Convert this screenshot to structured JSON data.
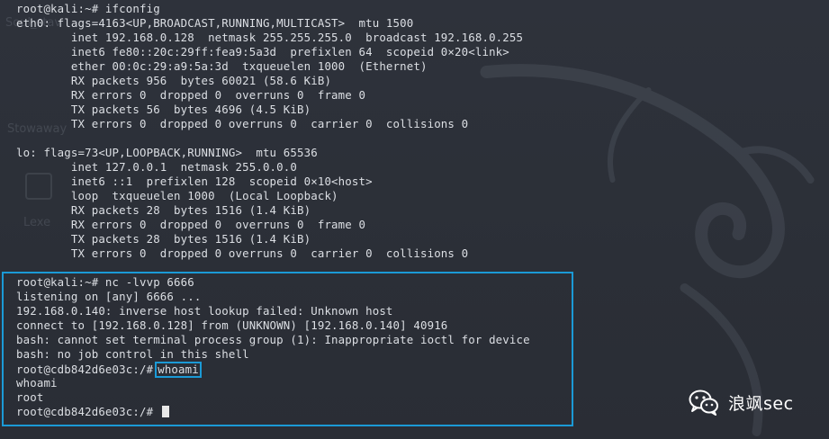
{
  "terminal": {
    "block1": [
      "root@kali:~# ifconfig",
      "eth0: flags=4163<UP,BROADCAST,RUNNING,MULTICAST>  mtu 1500",
      "        inet 192.168.0.128  netmask 255.255.255.0  broadcast 192.168.0.255",
      "        inet6 fe80::20c:29ff:fea9:5a3d  prefixlen 64  scopeid 0×20<link>",
      "        ether 00:0c:29:a9:5a:3d  txqueuelen 1000  (Ethernet)",
      "        RX packets 956  bytes 60021 (58.6 KiB)",
      "        RX errors 0  dropped 0  overruns 0  frame 0",
      "        TX packets 56  bytes 4696 (4.5 KiB)",
      "        TX errors 0  dropped 0 overruns 0  carrier 0  collisions 0",
      "",
      "lo: flags=73<UP,LOOPBACK,RUNNING>  mtu 65536",
      "        inet 127.0.0.1  netmask 255.0.0.0",
      "        inet6 ::1  prefixlen 128  scopeid 0×10<host>",
      "        loop  txqueuelen 1000  (Local Loopback)",
      "        RX packets 28  bytes 1516 (1.4 KiB)",
      "        RX errors 0  dropped 0  overruns 0  frame 0",
      "        TX packets 28  bytes 1516 (1.4 KiB)",
      "        TX errors 0  dropped 0 overruns 0  carrier 0  collisions 0"
    ],
    "block2": [
      "root@kali:~# nc -lvvp 6666",
      "listening on [any] 6666 ...",
      "192.168.0.140: inverse host lookup failed: Unknown host",
      "connect to [192.168.0.128] from (UNKNOWN) [192.168.0.140] 40916",
      "bash: cannot set terminal process group (1): Inappropriate ioctl for device",
      "bash: no job control in this shell"
    ],
    "shell_prompt": "root@cdb842d6e03c:/#",
    "shell_command": "whoami",
    "output_echo": "whoami",
    "output_result": "root",
    "final_prompt": "root@cdb842d6e03c:/#"
  },
  "watermark": {
    "text": "浪飒sec",
    "icon": "wechat-icon"
  },
  "colors": {
    "background": "#2b2f38",
    "text": "#dcdfe4",
    "highlight": "#1b9ad6"
  }
}
